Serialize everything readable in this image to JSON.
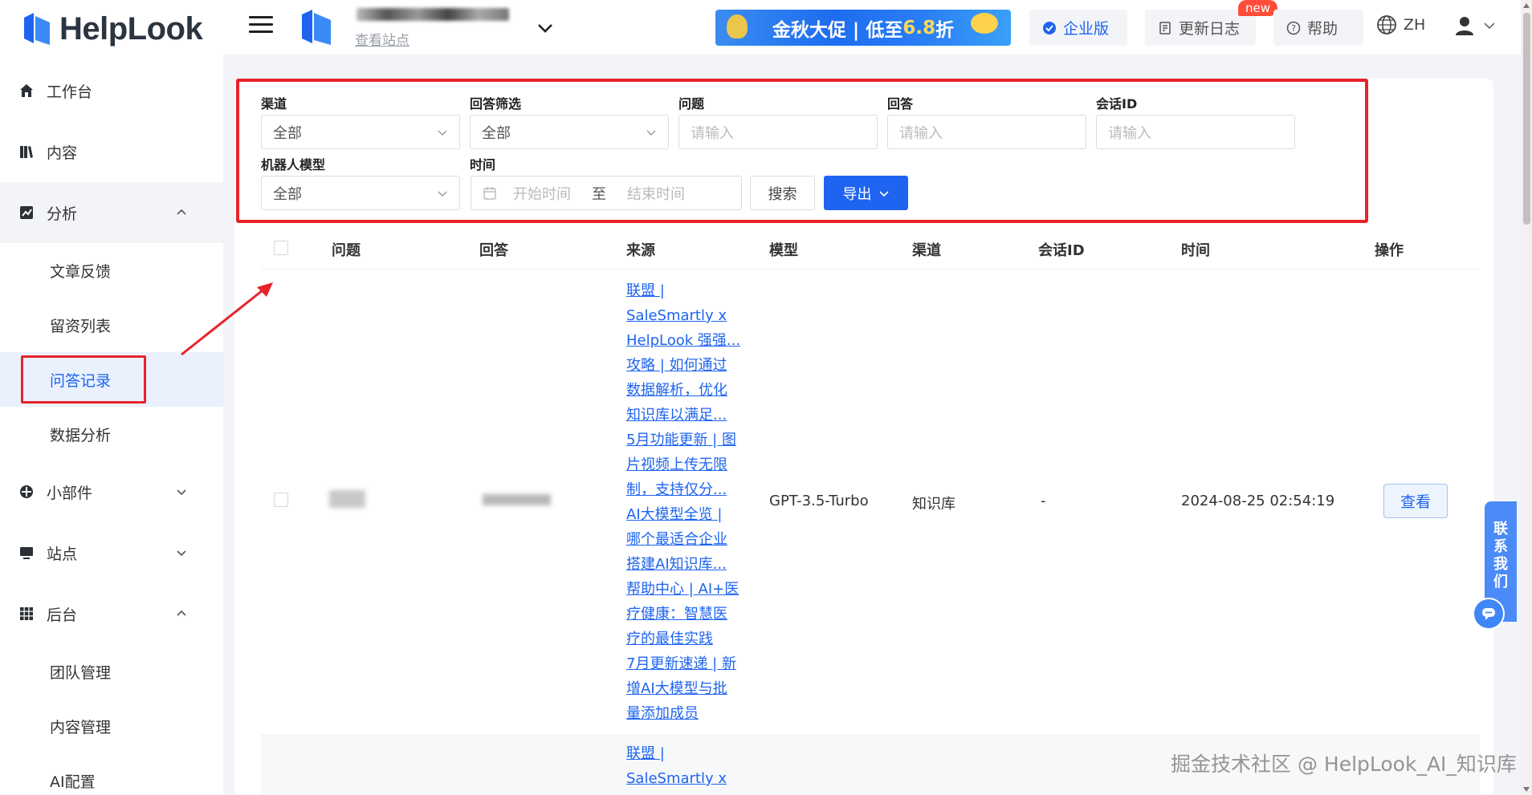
{
  "app": {
    "logo_text": "HelpLook",
    "view_site": "查看站点"
  },
  "header": {
    "promo_text_a": "金秋大促 | 低至",
    "promo_price": "6.8",
    "promo_text_b": "折",
    "enterprise": "企业版",
    "changelog": "更新日志",
    "new_badge": "new",
    "help": "帮助",
    "lang": "ZH"
  },
  "sidebar": {
    "items": [
      {
        "label": "工作台"
      },
      {
        "label": "内容"
      },
      {
        "label": "分析"
      },
      {
        "label": "文章反馈"
      },
      {
        "label": "留资列表"
      },
      {
        "label": "问答记录"
      },
      {
        "label": "数据分析"
      },
      {
        "label": "小部件"
      },
      {
        "label": "站点"
      },
      {
        "label": "后台"
      },
      {
        "label": "团队管理"
      },
      {
        "label": "内容管理"
      },
      {
        "label": "AI配置"
      }
    ]
  },
  "filters": {
    "channel_label": "渠道",
    "channel_value": "全部",
    "answer_filter_label": "回答筛选",
    "answer_filter_value": "全部",
    "question_label": "问题",
    "question_placeholder": "请输入",
    "answer_label": "回答",
    "answer_placeholder": "请输入",
    "session_label": "会话ID",
    "session_placeholder": "请输入",
    "model_label": "机器人模型",
    "model_value": "全部",
    "time_label": "时间",
    "start_placeholder": "开始时间",
    "range_sep": "至",
    "end_placeholder": "结束时间",
    "search_btn": "搜索",
    "export_btn": "导出"
  },
  "table": {
    "headers": [
      "问题",
      "回答",
      "来源",
      "模型",
      "渠道",
      "会话ID",
      "时间",
      "操作"
    ],
    "rows": [
      {
        "sources": [
          "联盟 |",
          "SaleSmartly x",
          "HelpLook 强强...",
          "攻略 | 如何通过",
          "数据解析，优化",
          "知识库以满足...",
          "5月功能更新 | 图",
          "片视频上传无限",
          "制，支持仅分...",
          "AI大模型全览 |",
          "哪个最适合企业",
          "搭建AI知识库...",
          "帮助中心 | AI+医",
          "疗健康：智慧医",
          "疗的最佳实践",
          "7月更新速递 | 新",
          "增AI大模型与批",
          "量添加成员"
        ],
        "model": "GPT-3.5-Turbo",
        "channel": "知识库",
        "session": "-",
        "time": "2024-08-25 02:54:19",
        "action": "查看"
      },
      {
        "sources": [
          "联盟 |",
          "SaleSmartly x"
        ]
      }
    ]
  },
  "contact": {
    "label": "联系我们"
  },
  "watermark": "掘金技术社区 @ HelpLook_AI_知识库"
}
